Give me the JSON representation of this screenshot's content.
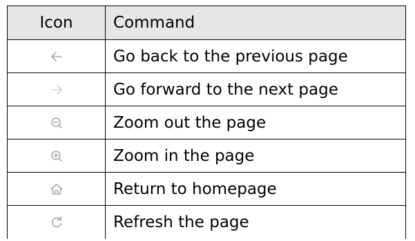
{
  "table": {
    "headers": {
      "icon": "Icon",
      "command": "Command"
    },
    "rows": [
      {
        "icon": "arrow-left-icon",
        "command": "Go back to the previous page"
      },
      {
        "icon": "arrow-right-icon",
        "command": "Go forward to the next page"
      },
      {
        "icon": "zoom-out-icon",
        "command": "Zoom out the page"
      },
      {
        "icon": "zoom-in-icon",
        "command": "Zoom in the page"
      },
      {
        "icon": "home-icon",
        "command": "Return to homepage"
      },
      {
        "icon": "refresh-icon",
        "command": "Refresh the page"
      }
    ]
  },
  "colors": {
    "header_background": "#e6e6e6",
    "icon_color": "#a8a8a8",
    "icon_disabled_color": "#cfcfcf",
    "border": "#000000"
  }
}
